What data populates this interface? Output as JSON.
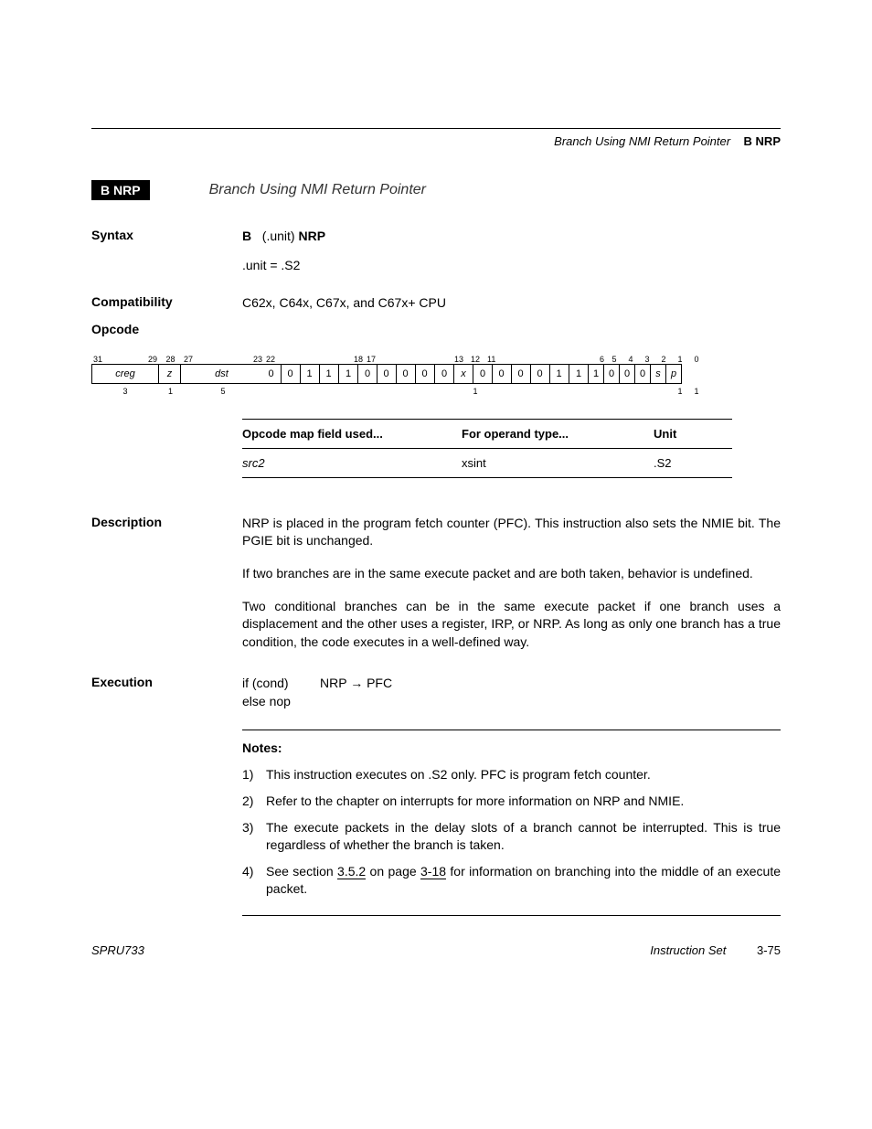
{
  "header": {
    "title_italic": "Branch Using NMI Return Pointer",
    "title_bold": "B NRP"
  },
  "badge": "B NRP",
  "title": "Branch Using NMI Return Pointer",
  "syntax": {
    "label": "Syntax",
    "line1_b": "B",
    "line1_unit": "(.unit)",
    "line1_nrp": "NRP",
    "line2": ".unit = .S2"
  },
  "compat": {
    "label": "Compatibility",
    "text": "C62x, C64x, C67x, and C67x+ CPU"
  },
  "opcode": {
    "label": "Opcode",
    "bit_nums_top": [
      "31",
      "29",
      "28",
      "27",
      "23",
      "22",
      "18",
      "17",
      "13",
      "12",
      "11",
      "6",
      "5",
      "4",
      "3",
      "2",
      "1",
      "0"
    ],
    "fields": {
      "creg": "creg",
      "z": "z",
      "dst": "dst",
      "fixed1": [
        "0",
        "0",
        "1",
        "1",
        "1"
      ],
      "fixed2": [
        "0",
        "0",
        "0",
        "0",
        "0"
      ],
      "x": "x",
      "fixed3": [
        "0",
        "0",
        "0",
        "0",
        "1",
        "1"
      ],
      "b5": "1",
      "b4": "0",
      "b3": "0",
      "b2": "0",
      "s": "s",
      "p": "p"
    },
    "widths": {
      "creg": "3",
      "z": "1",
      "dst": "5",
      "x": "1",
      "s": "1",
      "p": "1"
    }
  },
  "maptable": {
    "h1": "Opcode map field used...",
    "h2": "For operand type...",
    "h3": "Unit",
    "r1c1": "src2",
    "r1c2": "xsint",
    "r1c3": ".S2"
  },
  "description": {
    "label": "Description",
    "p1": "NRP is placed in the program fetch counter (PFC). This instruction also sets the NMIE bit. The PGIE bit is unchanged.",
    "p2": "If two branches are in the same execute packet and are both taken, behavior is undefined.",
    "p3": "Two conditional branches can be in the same execute packet if one branch uses a displacement and the other uses a register, IRP, or NRP. As long as only one branch has a true condition, the code executes in a well-defined way."
  },
  "execution": {
    "label": "Execution",
    "ifcond": "if (cond)",
    "expr": "NRP → PFC",
    "elsenop": "else nop"
  },
  "notes": {
    "title": "Notes:",
    "items": [
      {
        "n": "1)",
        "t": "This instruction executes on .S2 only. PFC is program fetch counter."
      },
      {
        "n": "2)",
        "t": "Refer to the chapter on interrupts for more information on NRP and NMIE."
      },
      {
        "n": "3)",
        "t": "The execute packets in the delay slots of a branch cannot be interrupted. This is true regardless of whether the branch is taken."
      },
      {
        "n": "4)",
        "pre": "See section ",
        "link1": "3.5.2",
        "mid": " on page ",
        "link2": "3-18",
        "post": " for information on branching into the middle of an execute packet."
      }
    ]
  },
  "footer": {
    "left": "SPRU733",
    "right1": "Instruction Set",
    "right2": "3-75"
  }
}
